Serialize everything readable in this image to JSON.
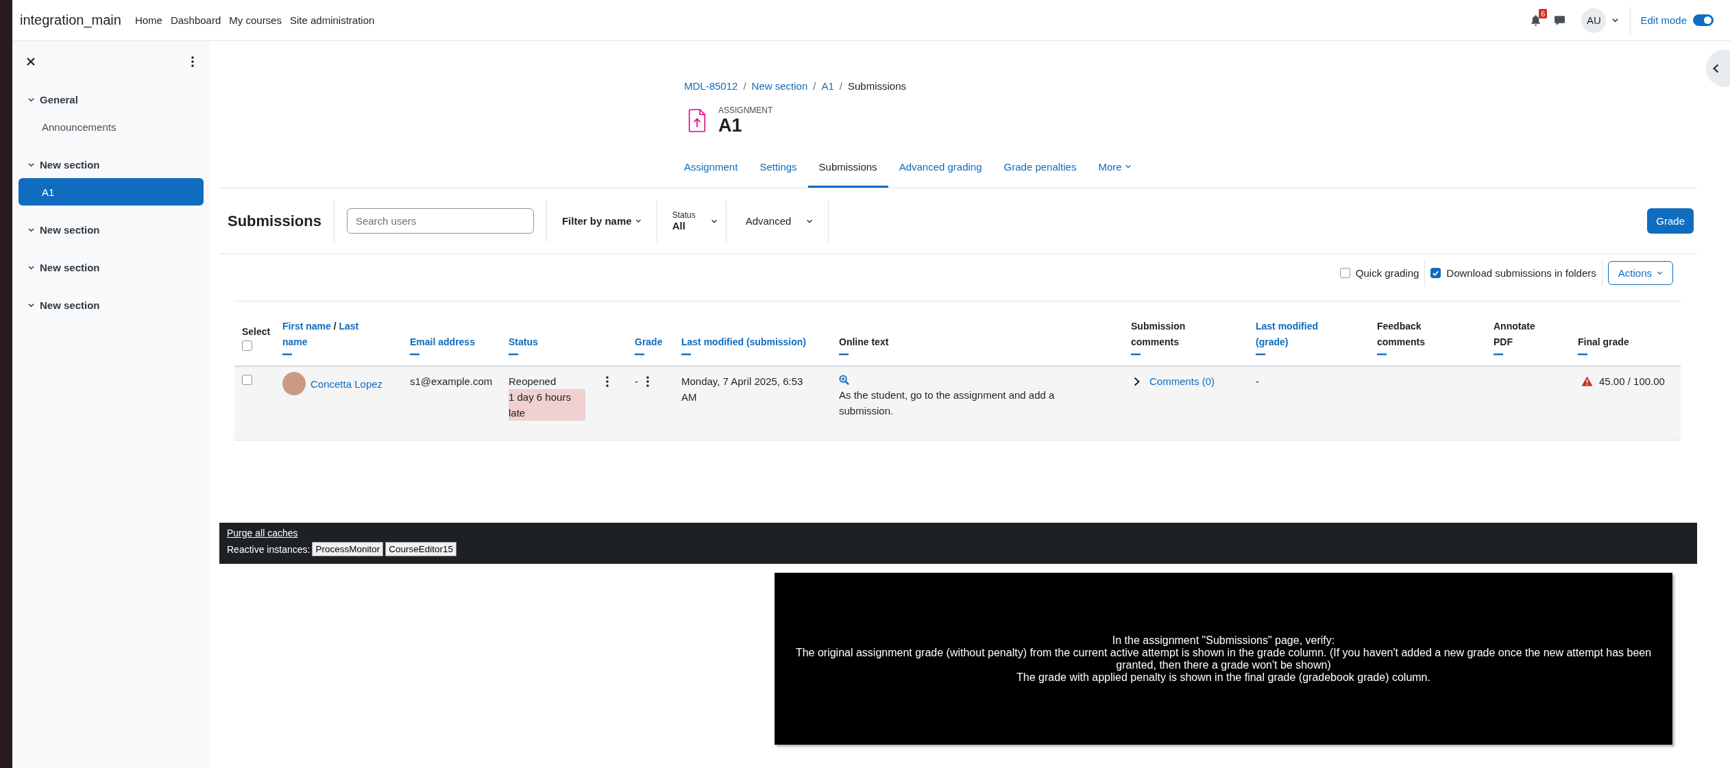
{
  "navbar": {
    "site_name": "integration_main",
    "links": [
      "Home",
      "Dashboard",
      "My courses",
      "Site administration"
    ],
    "notification_count": "6",
    "avatar_initials": "AU",
    "edit_mode": {
      "label": "Edit mode",
      "on": true
    }
  },
  "course_index": {
    "sections": [
      {
        "title": "General",
        "expanded": true,
        "items": [
          {
            "label": "Announcements",
            "selected": false
          }
        ]
      },
      {
        "title": "New section",
        "expanded": true,
        "items": [
          {
            "label": "A1",
            "selected": true
          }
        ]
      },
      {
        "title": "New section",
        "expanded": true
      },
      {
        "title": "New section",
        "expanded": true
      },
      {
        "title": "New section",
        "expanded": true
      }
    ]
  },
  "breadcrumb": [
    {
      "label": "MDL-85012",
      "kind": "link"
    },
    {
      "label": "/",
      "kind": "separator"
    },
    {
      "label": "New section",
      "kind": "link"
    },
    {
      "label": "/",
      "kind": "separator"
    },
    {
      "label": "A1",
      "kind": "link"
    },
    {
      "label": "/",
      "kind": "separator"
    },
    {
      "label": "Submissions",
      "kind": "current"
    }
  ],
  "activity": {
    "type_label": "ASSIGNMENT",
    "title": "A1"
  },
  "tabs": [
    {
      "label": "Assignment",
      "selected": false,
      "kind": "tab"
    },
    {
      "label": "Settings",
      "selected": false,
      "kind": "tab"
    },
    {
      "label": "Submissions",
      "selected": true,
      "kind": "tab"
    },
    {
      "label": "Advanced grading",
      "selected": false,
      "kind": "tab"
    },
    {
      "label": "Grade penalties",
      "selected": false,
      "kind": "tab"
    },
    {
      "label": "More",
      "selected": false,
      "kind": "menu"
    }
  ],
  "toolbar": {
    "heading": "Submissions",
    "search": {
      "placeholder": "Search users"
    },
    "name_filter": "Filter by name",
    "status_filter": {
      "label": "Status",
      "value": "All"
    },
    "advanced": "Advanced",
    "grade_button": "Grade"
  },
  "options": {
    "quick_grading": {
      "label": "Quick grading",
      "checked": false
    },
    "download_in_folders": {
      "label": "Download submissions in folders",
      "checked": true
    },
    "actions_button": "Actions"
  },
  "table": {
    "select_all": {
      "checked": false
    },
    "columns": [
      {
        "kind": "select",
        "label": "Select",
        "link": false
      },
      {
        "kind": "name",
        "parts": [
          {
            "text": "First name",
            "link": true
          },
          {
            "text": "/",
            "link": false
          },
          {
            "text": "Last name",
            "link": true
          }
        ]
      },
      {
        "kind": "text",
        "label": "Email address",
        "link": true
      },
      {
        "kind": "text",
        "label": "Status",
        "link": true
      },
      {
        "kind": "text",
        "label": "Grade",
        "link": true
      },
      {
        "kind": "text",
        "label": "Last modified (submission)",
        "link": true
      },
      {
        "kind": "text",
        "label": "Online text",
        "link": false
      },
      {
        "kind": "text",
        "label": "Submission comments",
        "link": false
      },
      {
        "kind": "text",
        "label": "Last modified (grade)",
        "link": true
      },
      {
        "kind": "text",
        "label": "Feedback comments",
        "link": false
      },
      {
        "kind": "text",
        "label": "Annotate PDF",
        "link": false
      },
      {
        "kind": "text",
        "label": "Final grade",
        "link": false
      }
    ],
    "rows": [
      {
        "selected": false,
        "name": "Concetta Lopez",
        "email": "s1@example.com",
        "status": "Reopened",
        "status_note": "1 day 6 hours late",
        "grade": "-",
        "last_modified": "Monday, 7 April 2025, 6:53 AM",
        "online_text": "As the student, go to the assignment and add a submission.",
        "comments": "Comments (0)",
        "comments_expanded": false,
        "last_modified_grade": "-",
        "final_grade": "45.00 / 100.00",
        "final_grade_warning": true
      }
    ]
  },
  "dev_footer": {
    "purge_link": "Purge all caches",
    "reactive_label": "Reactive instances:",
    "instances": [
      "ProcessMonitor",
      "CourseEditor15"
    ]
  },
  "instructions": [
    "In the assignment \"Submissions\" page, verify:",
    "The original assignment grade (without penalty) from the current active attempt is shown in the grade column. (If you haven't added a new grade once the new attempt has been granted, then there a grade won't be shown)",
    "The grade with applied penalty is shown in the final grade (gradebook grade) column."
  ]
}
